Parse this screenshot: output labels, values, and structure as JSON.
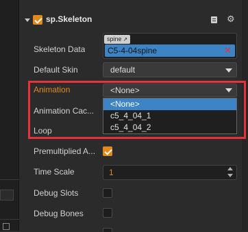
{
  "component": {
    "name": "sp.Skeleton",
    "enabled": true
  },
  "properties": {
    "skeleton_data": {
      "label": "Skeleton Data",
      "tag": "spine",
      "value": "C5-4-04spine"
    },
    "default_skin": {
      "label": "Default Skin",
      "value": "default"
    },
    "animation": {
      "label": "Animation",
      "value": "<None>",
      "options": [
        "<None>",
        "c5_4_04_1",
        "c5_4_04_2"
      ]
    },
    "animation_cache": {
      "label": "Animation Cac..."
    },
    "loop": {
      "label": "Loop"
    },
    "premultiplied_alpha": {
      "label": "Premultiplied A...",
      "checked": true
    },
    "time_scale": {
      "label": "Time Scale",
      "value": "1"
    },
    "debug_slots": {
      "label": "Debug Slots",
      "checked": false
    },
    "debug_bones": {
      "label": "Debug Bones",
      "checked": false
    }
  },
  "colors": {
    "accent": "#e08a1e",
    "highlight": "#e8323b",
    "selection": "#3c84c6",
    "asset_field": "#3c84c6"
  }
}
